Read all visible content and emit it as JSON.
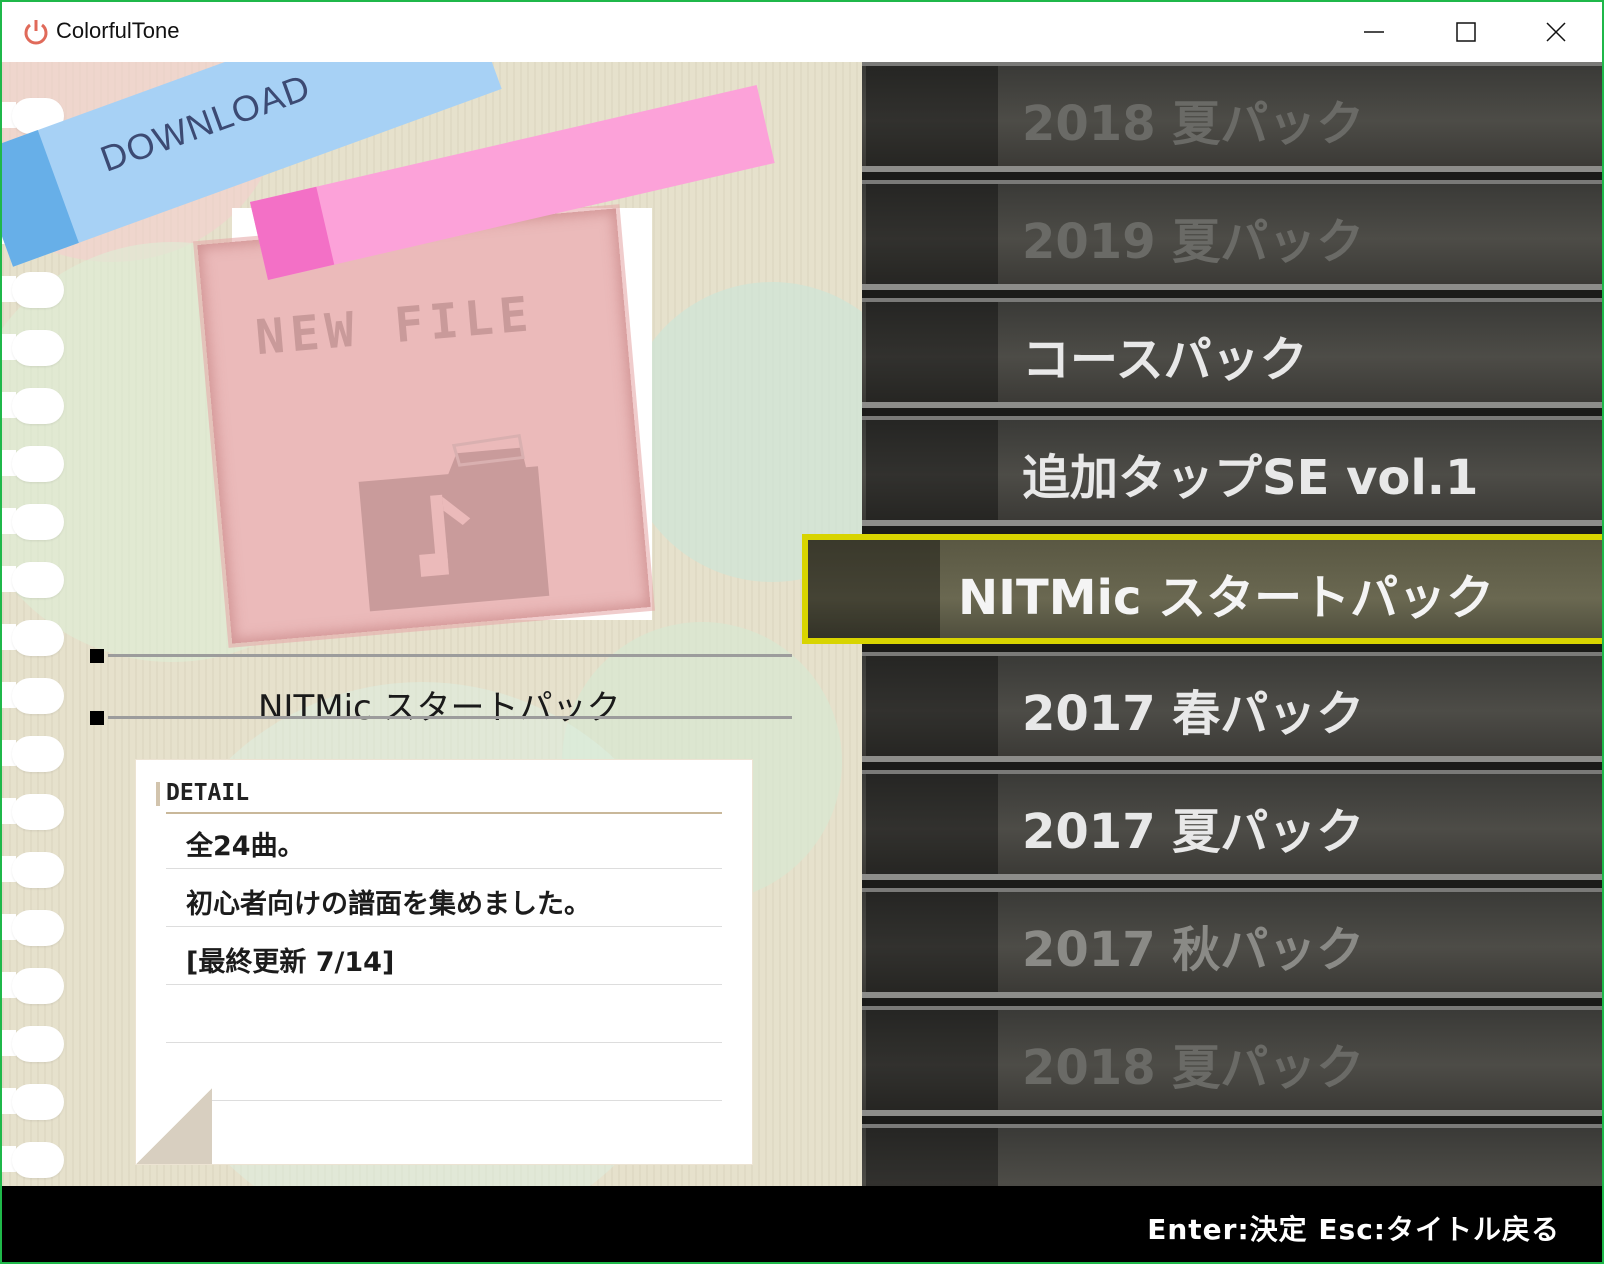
{
  "window": {
    "title": "ColorfulTone",
    "border_color": "#1fb84a"
  },
  "left": {
    "tape_label": "DOWNLOAD",
    "card_title": "NEW FILE",
    "selected_name": "NITMic スタートパック",
    "detail": {
      "heading": "DETAIL",
      "lines": [
        "全24曲。",
        "初心者向けの譜面を集めました。",
        "[最終更新 7/14]"
      ]
    }
  },
  "menu": {
    "items": [
      {
        "label": "2018 夏パック",
        "state": "faded"
      },
      {
        "label": "2019 夏パック",
        "state": "faded"
      },
      {
        "label": "コースパック",
        "state": "normal"
      },
      {
        "label": "追加タップSE vol.1",
        "state": "normal"
      },
      {
        "label": "NITMic スタートパック",
        "state": "selected"
      },
      {
        "label": "2017 春パック",
        "state": "normal"
      },
      {
        "label": "2017 夏パック",
        "state": "normal"
      },
      {
        "label": "2017 秋パック",
        "state": "dim"
      },
      {
        "label": "2018 夏パック",
        "state": "faded"
      }
    ],
    "highlight_color": "#d8d400"
  },
  "footer": {
    "hint": "Enter:決定 Esc:タイトル戻る"
  }
}
